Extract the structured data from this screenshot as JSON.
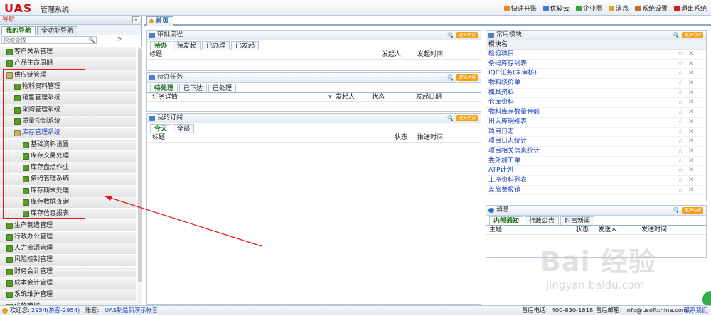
{
  "app": {
    "logo": "UAS",
    "system_name": "管理系统"
  },
  "top_links": [
    {
      "label": "快速开账",
      "icon": "quick-open-icon",
      "color": "#e58a1f"
    },
    {
      "label": "优软云",
      "icon": "cloud-icon",
      "color": "#3b7fd0"
    },
    {
      "label": "企业圈",
      "icon": "circle-icon",
      "color": "#3aa13b"
    },
    {
      "label": "消息",
      "icon": "message-icon",
      "color": "#e0a321"
    },
    {
      "label": "系统设置",
      "icon": "settings-icon",
      "color": "#d06a22"
    },
    {
      "label": "退出系统",
      "icon": "power-icon",
      "color": "#d2201e"
    }
  ],
  "sidebar": {
    "header": "导航",
    "collapse_label": "«",
    "tabs": [
      {
        "label": "我的导航"
      },
      {
        "label": "全功能导航"
      }
    ],
    "search_placeholder": "快速查找",
    "items": [
      {
        "label": "客户关系管理",
        "level": 0
      },
      {
        "label": "产品生命周期",
        "level": 0
      },
      {
        "label": "供应链管理",
        "level": 0,
        "open": true
      },
      {
        "label": "物料资料管理",
        "level": 1
      },
      {
        "label": "销售管理系统",
        "level": 1
      },
      {
        "label": "采购管理系统",
        "level": 1
      },
      {
        "label": "质量控制系统",
        "level": 1
      },
      {
        "label": "库存管理系统",
        "level": 1,
        "open": true,
        "selected": true
      },
      {
        "label": "基础资料设置",
        "level": 2
      },
      {
        "label": "库存交易处理",
        "level": 2
      },
      {
        "label": "库存盘点作业",
        "level": 2
      },
      {
        "label": "条码管理系统",
        "level": 2
      },
      {
        "label": "库存期末处理",
        "level": 2
      },
      {
        "label": "库存数据查询",
        "level": 2
      },
      {
        "label": "库存信息报表",
        "level": 2
      },
      {
        "label": "生产制造管理",
        "level": 0
      },
      {
        "label": "行政办公管理",
        "level": 0
      },
      {
        "label": "人力资源管理",
        "level": 0
      },
      {
        "label": "风险控制管理",
        "level": 0
      },
      {
        "label": "财务会计管理",
        "level": 0
      },
      {
        "label": "成本会计管理",
        "level": 0
      },
      {
        "label": "系统维护管理",
        "level": 0
      },
      {
        "label": "优软商城",
        "level": 0
      }
    ]
  },
  "main": {
    "home_tab": "首页",
    "more_label": "更多内容",
    "approval": {
      "title": "审批流程",
      "tabs": [
        "待办",
        "待发起",
        "已办理",
        "已发起"
      ],
      "columns": [
        "标题",
        "发起人",
        "发起时间"
      ]
    },
    "todo": {
      "title": "待办任务",
      "tabs": [
        "待处理",
        "已下达",
        "已处理"
      ],
      "columns": [
        "任务详情",
        "发起人",
        "状态",
        "发起日期"
      ]
    },
    "subscribe": {
      "title": "我的订阅",
      "tabs": [
        "今天",
        "全部"
      ],
      "columns": [
        "标题",
        "状态",
        "推送时间"
      ]
    },
    "common": {
      "title": "常用模块",
      "column": "模块名",
      "items": [
        "检验项目",
        "条码库存列表",
        "IQC任务(未审核)",
        "物料核价单",
        "模具资料",
        "仓库资料",
        "物料库存数量金额",
        "出入库明细表",
        "项目日志",
        "项目日志统计",
        "项目相关信息统计",
        "委外加工单",
        "ATP计划",
        "工序资料列表",
        "差旅费报销"
      ]
    },
    "messages": {
      "title": "消息",
      "tabs": [
        "内部通知",
        "行政公告",
        "时事新闻"
      ],
      "columns": [
        "主题",
        "状态",
        "发送人",
        "发送时间"
      ]
    }
  },
  "statusbar": {
    "welcome_label": "欢迎您:",
    "user": "2954(游客-2954)",
    "account_label": "账套:",
    "account": "UAS制造新演示帐套",
    "hotline": "售后电话：400-830-1818",
    "email": "售后邮箱：info@usoftchina.com",
    "contact": "联系我们"
  },
  "watermark": {
    "text": "Bai 经验",
    "url": "jingyan.baidu.com"
  },
  "colors": {
    "accent": "#1c6e1a",
    "link": "#1a3fb4",
    "annotation": "#e8161a",
    "logo": "#d2141b"
  }
}
